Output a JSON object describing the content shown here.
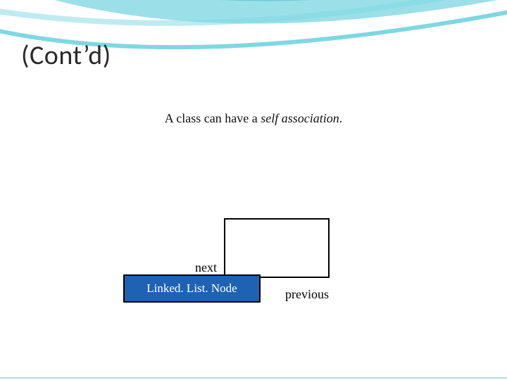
{
  "title": "(Cont’d)",
  "intro": {
    "pre": "A class can have a ",
    "emph": "self association",
    "post": "."
  },
  "diagram": {
    "node_label": "Linked. List. Node",
    "next_label": "next",
    "prev_label": "previous"
  }
}
